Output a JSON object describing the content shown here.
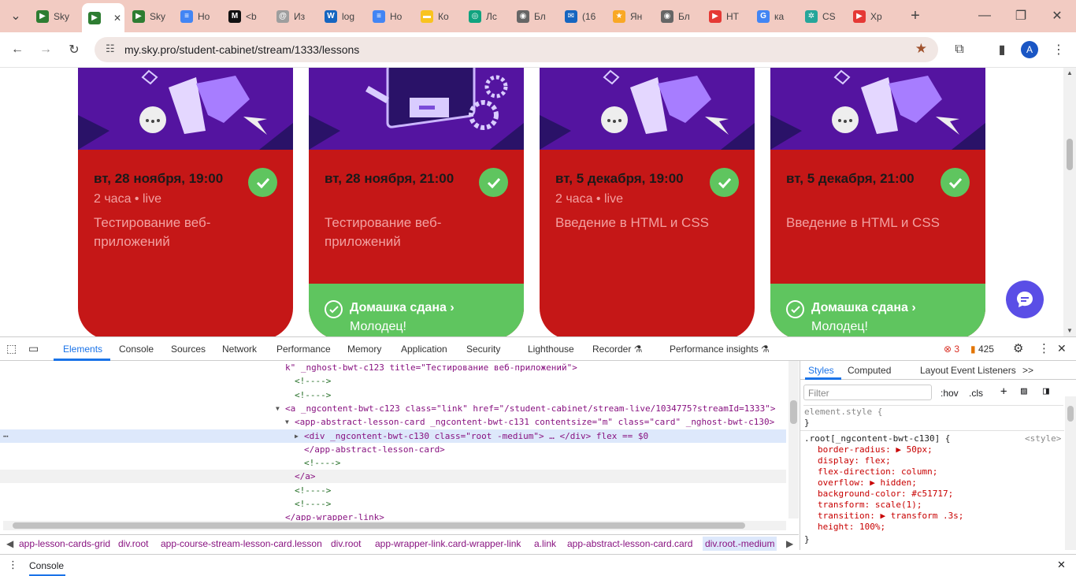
{
  "tabs": [
    {
      "label": "Sky",
      "fav_color": "#2e7d32",
      "fav": "▶"
    },
    {
      "label": "Sky",
      "fav_color": "#2e7d32",
      "fav": "▶",
      "active": true
    },
    {
      "label": "Sky",
      "fav_color": "#2e7d32",
      "fav": "▶"
    },
    {
      "label": "Но",
      "fav_color": "#4285f4",
      "fav": "≡"
    },
    {
      "label": "<b",
      "fav_color": "#111111",
      "fav": "M"
    },
    {
      "label": "Из",
      "fav_color": "#9e9e9e",
      "fav": "@"
    },
    {
      "label": "log",
      "fav_color": "#1565c0",
      "fav": "W"
    },
    {
      "label": "Но",
      "fav_color": "#4285f4",
      "fav": "≡"
    },
    {
      "label": "Ко",
      "fav_color": "#f9c31f",
      "fav": "▬"
    },
    {
      "label": "Лс",
      "fav_color": "#10a37f",
      "fav": "◎"
    },
    {
      "label": "Бл",
      "fav_color": "#666666",
      "fav": "◉"
    },
    {
      "label": "(16",
      "fav_color": "#1565c0",
      "fav": "✉"
    },
    {
      "label": "Ян",
      "fav_color": "#f9a825",
      "fav": "★"
    },
    {
      "label": "Бл",
      "fav_color": "#666666",
      "fav": "◉"
    },
    {
      "label": "НТ",
      "fav_color": "#e53935",
      "fav": "▶"
    },
    {
      "label": "ка",
      "fav_color": "#4285f4",
      "fav": "G"
    },
    {
      "label": "CS",
      "fav_color": "#26a69a",
      "fav": "✲"
    },
    {
      "label": "Хр",
      "fav_color": "#e53935",
      "fav": "▶"
    }
  ],
  "url": "my.sky.pro/student-cabinet/stream/1333/lessons",
  "profile_initial": "A",
  "cards": [
    {
      "date": "вт, 28 ноября, 19:00",
      "meta": "2 часа   • live",
      "title": "Тестирование веб-приложений",
      "homework": null
    },
    {
      "date": "вт, 28 ноября, 21:00",
      "meta": "",
      "title": "Тестирование веб-приложений",
      "homework": {
        "status": "Домашка сдана",
        "note": "Молодец!"
      }
    },
    {
      "date": "вт, 5 декабря, 19:00",
      "meta": "2 часа   • live",
      "title": "Введение в HTML и CSS",
      "homework": null
    },
    {
      "date": "вт, 5 декабря, 21:00",
      "meta": "",
      "title": "Введение в HTML и CSS",
      "homework": {
        "status": "Домашка сдана",
        "note": "Молодец!"
      }
    }
  ],
  "devtools": {
    "tabs": [
      "Elements",
      "Console",
      "Sources",
      "Network",
      "Performance",
      "Memory",
      "Application",
      "Security",
      "Lighthouse",
      "Recorder ⚗",
      "Performance insights ⚗"
    ],
    "errors": "3",
    "warnings": "425",
    "dom_lines": [
      "k\" _nghost-bwt-c123 title=\"Тестирование веб-приложений\">",
      "<!---->",
      "<!---->",
      "<a _ngcontent-bwt-c123 class=\"link\" href=\"/student-cabinet/stream-live/1034775?streamId=1333\">",
      "<app-abstract-lesson-card _ngcontent-bwt-c131 contentsize=\"m\" class=\"card\" _nghost-bwt-c130>",
      "<div _ngcontent-bwt-c130 class=\"root -medium\"> … </div>  flex  == $0",
      "</app-abstract-lesson-card>",
      "<!---->",
      "</a>",
      "<!---->",
      "<!---->",
      "</app-wrapper-link>"
    ],
    "styles_tabs": [
      "Styles",
      "Computed",
      "Layout",
      "Event Listeners",
      ">>"
    ],
    "filter_placeholder": "Filter",
    "hov": ":hov",
    "cls": ".cls",
    "element_style": "element.style {",
    "selector": ".root[_ngcontent-bwt-c130] {",
    "source": "<style>",
    "props": [
      "border-radius: ▶ 50px;",
      "display: flex;",
      "flex-direction: column;",
      "overflow: ▶ hidden;",
      "background-color: #c51717;",
      "transform: scale(1);",
      "transition: ▶ transform .3s;",
      "height: 100%;"
    ],
    "breadcrumbs": [
      "app-lesson-cards-grid",
      "div.root",
      "app-course-stream-lesson-card.lesson",
      "div.root",
      "app-wrapper-link.card-wrapper-link",
      "a.link",
      "app-abstract-lesson-card.card",
      "div.root.-medium"
    ],
    "drawer_tab": "Console"
  },
  "colors": {
    "card_red": "#c51717",
    "green": "#5fc55f",
    "purple": "#5414a0",
    "chat": "#5a4ee6",
    "accent": "#1a73e8"
  }
}
